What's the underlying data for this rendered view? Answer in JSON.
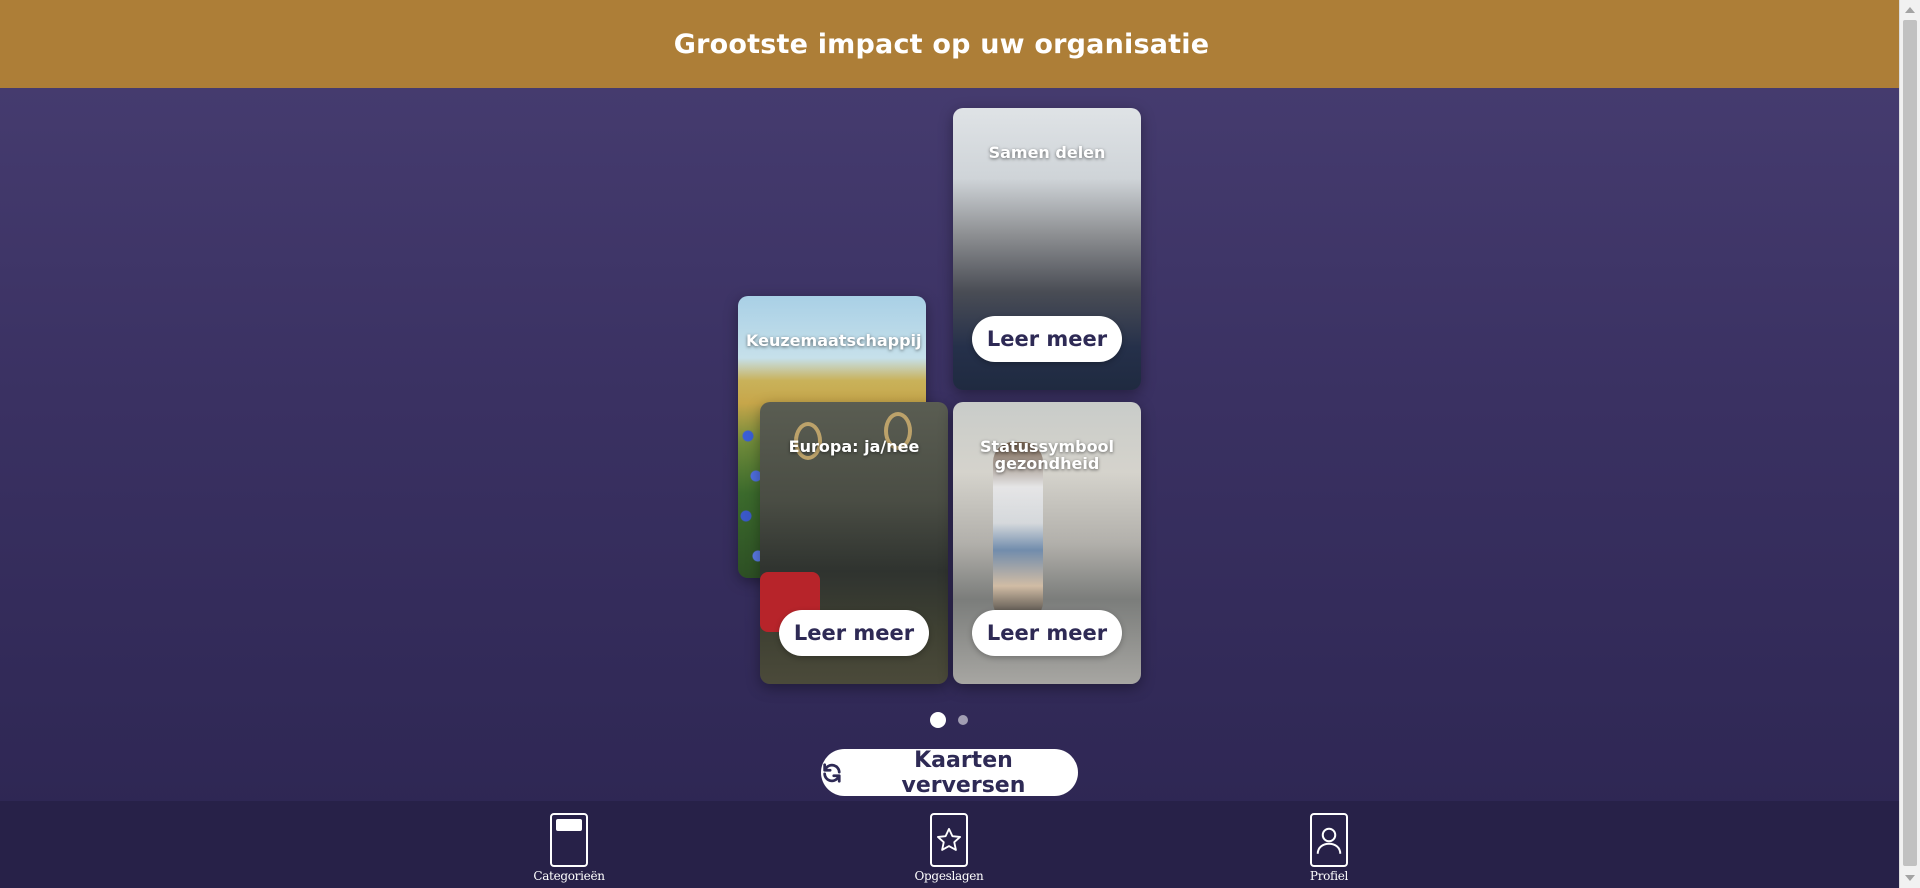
{
  "header": {
    "title": "Grootste impact op uw organisatie"
  },
  "cards": [
    {
      "id": "keuze",
      "title": "Keuzemaatschappij"
    },
    {
      "id": "samen",
      "title": "Samen delen",
      "button": "Leer meer"
    },
    {
      "id": "europa",
      "title": "Europa: ja/nee",
      "button": "Leer meer"
    },
    {
      "id": "status",
      "title": "Statussymbool gezondheid",
      "button": "Leer meer"
    }
  ],
  "pagination": {
    "total": 2,
    "active": 1
  },
  "refresh_button": {
    "label": "Kaarten verversen",
    "icon": "refresh-icon"
  },
  "bottom_nav": [
    {
      "label": "Categorieën",
      "icon": "categories-icon"
    },
    {
      "label": "Opgeslagen",
      "icon": "star-icon"
    },
    {
      "label": "Profiel",
      "icon": "profile-icon"
    }
  ],
  "colors": {
    "header": "#ad7e37",
    "background": "#3a3162",
    "nav": "#272148",
    "button_text": "#2e2a55"
  }
}
